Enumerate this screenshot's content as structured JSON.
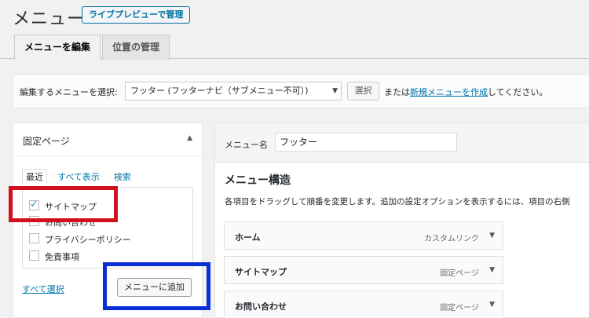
{
  "header": {
    "title": "メニュー",
    "live_preview_button": "ライブプレビューで管理"
  },
  "tabs": [
    {
      "label": "メニューを編集",
      "active": true
    },
    {
      "label": "位置の管理",
      "active": false
    }
  ],
  "select_bar": {
    "label": "編集するメニューを選択:",
    "selected_menu": "フッター (フッターナビ（サブメニュー不可）)",
    "select_button": "選択",
    "or_text": "または",
    "create_link": "新規メニューを作成",
    "suffix_text": "してください。"
  },
  "left_panel": {
    "title": "固定ページ",
    "sub_tabs": [
      {
        "label": "最近",
        "active": true
      },
      {
        "label": "すべて表示",
        "active": false
      },
      {
        "label": "検索",
        "active": false
      }
    ],
    "pages": [
      {
        "label": "サイトマップ",
        "checked": true
      },
      {
        "label": "お問い合わせ",
        "checked": false
      },
      {
        "label": "プライバシーポリシー",
        "checked": false
      },
      {
        "label": "免責事項",
        "checked": false
      }
    ],
    "select_all": "すべて選択",
    "add_button": "メニューに追加"
  },
  "right_panel": {
    "menu_name_label": "メニュー名",
    "menu_name_value": "フッター",
    "structure_title": "メニュー構造",
    "structure_desc": "各項目をドラッグして順番を変更します。追加の設定オプションを表示するには、項目の右側",
    "items": [
      {
        "title": "ホーム",
        "type": "カスタムリンク"
      },
      {
        "title": "サイトマップ",
        "type": "固定ページ"
      },
      {
        "title": "お問い合わせ",
        "type": "固定ページ"
      }
    ]
  },
  "annotation_colors": {
    "highlight_red": "#d1121e",
    "highlight_blue": "#0a2ed4"
  }
}
